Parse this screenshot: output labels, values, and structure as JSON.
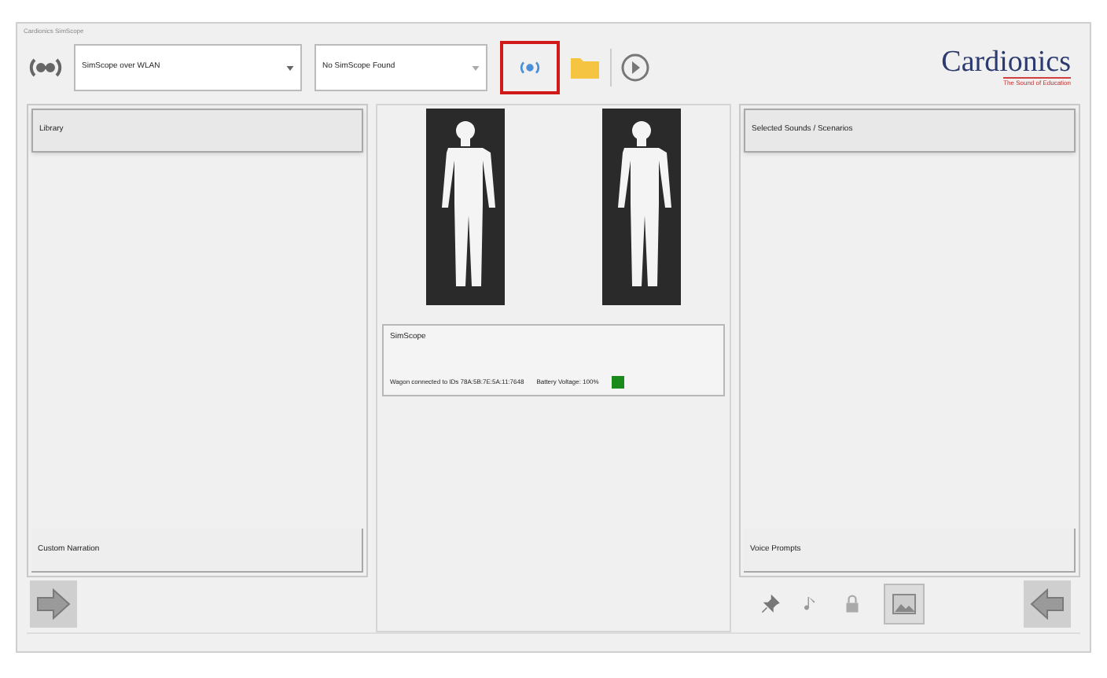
{
  "window": {
    "title": "Cardionics SimScope"
  },
  "toolbar": {
    "connection_dropdown": {
      "value": "SimScope over WLAN"
    },
    "device_dropdown": {
      "value": "No SimScope Found"
    },
    "wireless_button": {
      "highlighted": true
    },
    "logo": {
      "name": "Cardionics",
      "tagline": "The Sound of Education"
    }
  },
  "library_panel": {
    "header": "Library",
    "footer": "Custom Narration"
  },
  "simscope_panel": {
    "title": "SimScope",
    "connection": "Wagon connected to IDs 78A:5B:7E:5A:11:7648",
    "battery": "Battery Voltage: 100%",
    "battery_ok": true
  },
  "selected_panel": {
    "header": "Selected Sounds / Scenarios",
    "footer": "Voice Prompts"
  }
}
